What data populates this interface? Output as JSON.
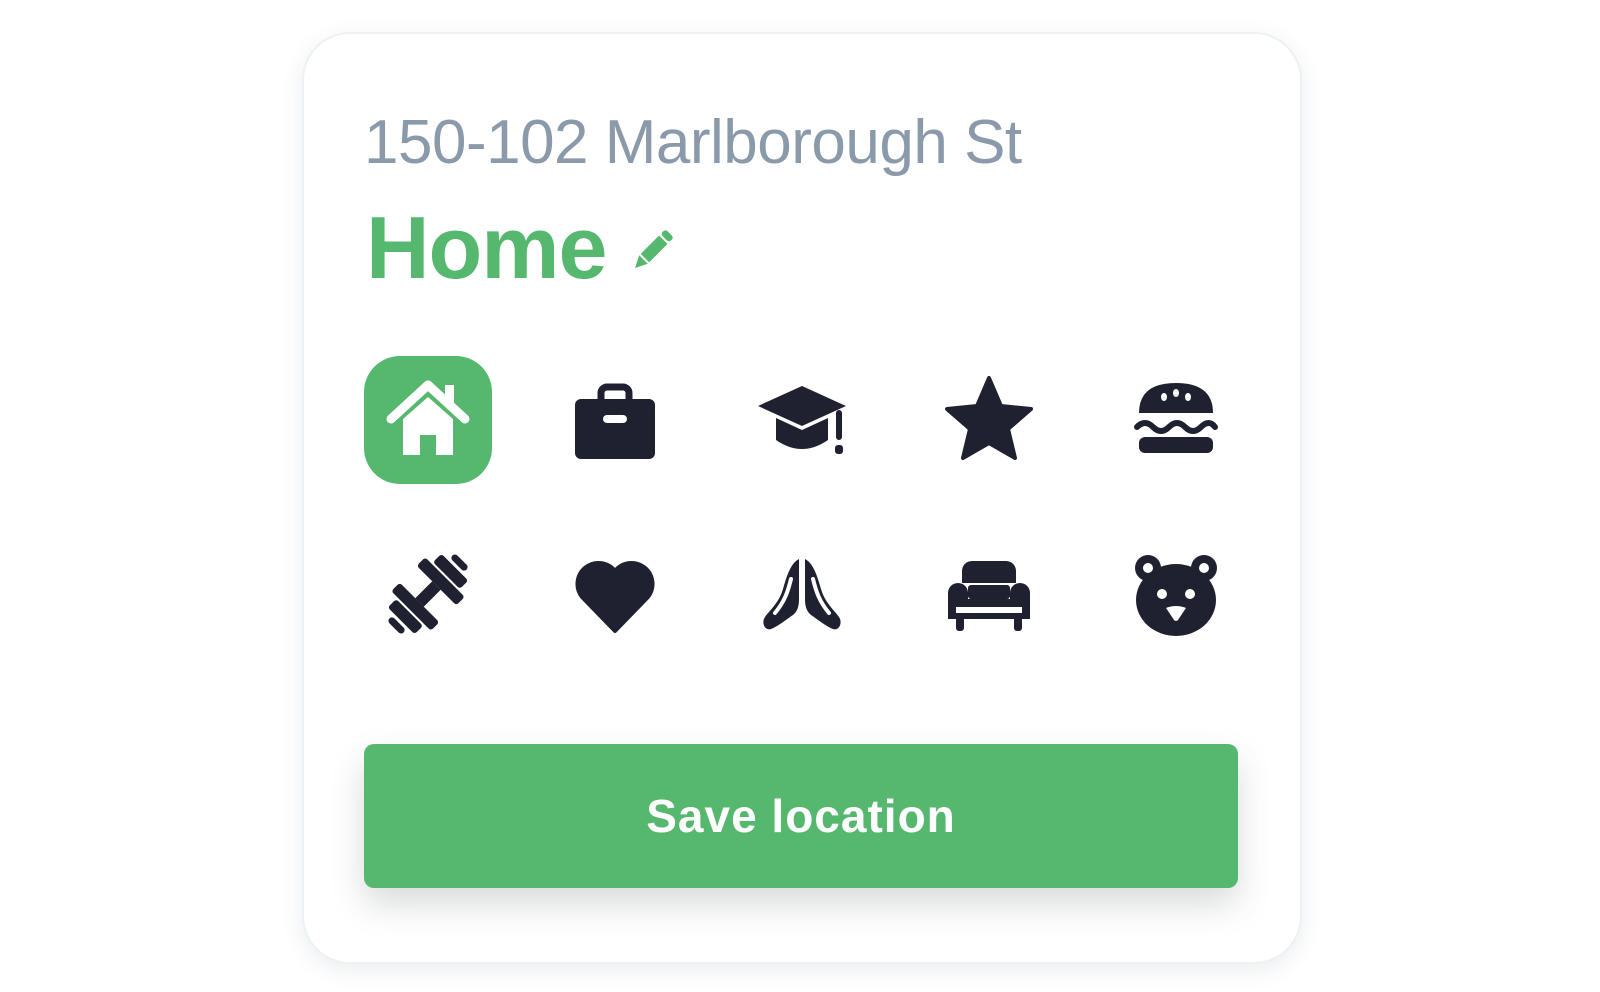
{
  "location": {
    "address": "150-102 Marlborough St",
    "name": "Home",
    "edit_icon": "pencil-icon"
  },
  "icons": {
    "selected": "home",
    "items": [
      "home",
      "briefcase",
      "graduation-cap",
      "star",
      "burger",
      "dumbbell",
      "heart",
      "praying-hands",
      "couch",
      "bear"
    ]
  },
  "actions": {
    "save_label": "Save location"
  },
  "colors": {
    "accent": "#56b86f",
    "address_text": "#8a9aab",
    "icon": "#1f2130",
    "background": "#ffffff"
  }
}
